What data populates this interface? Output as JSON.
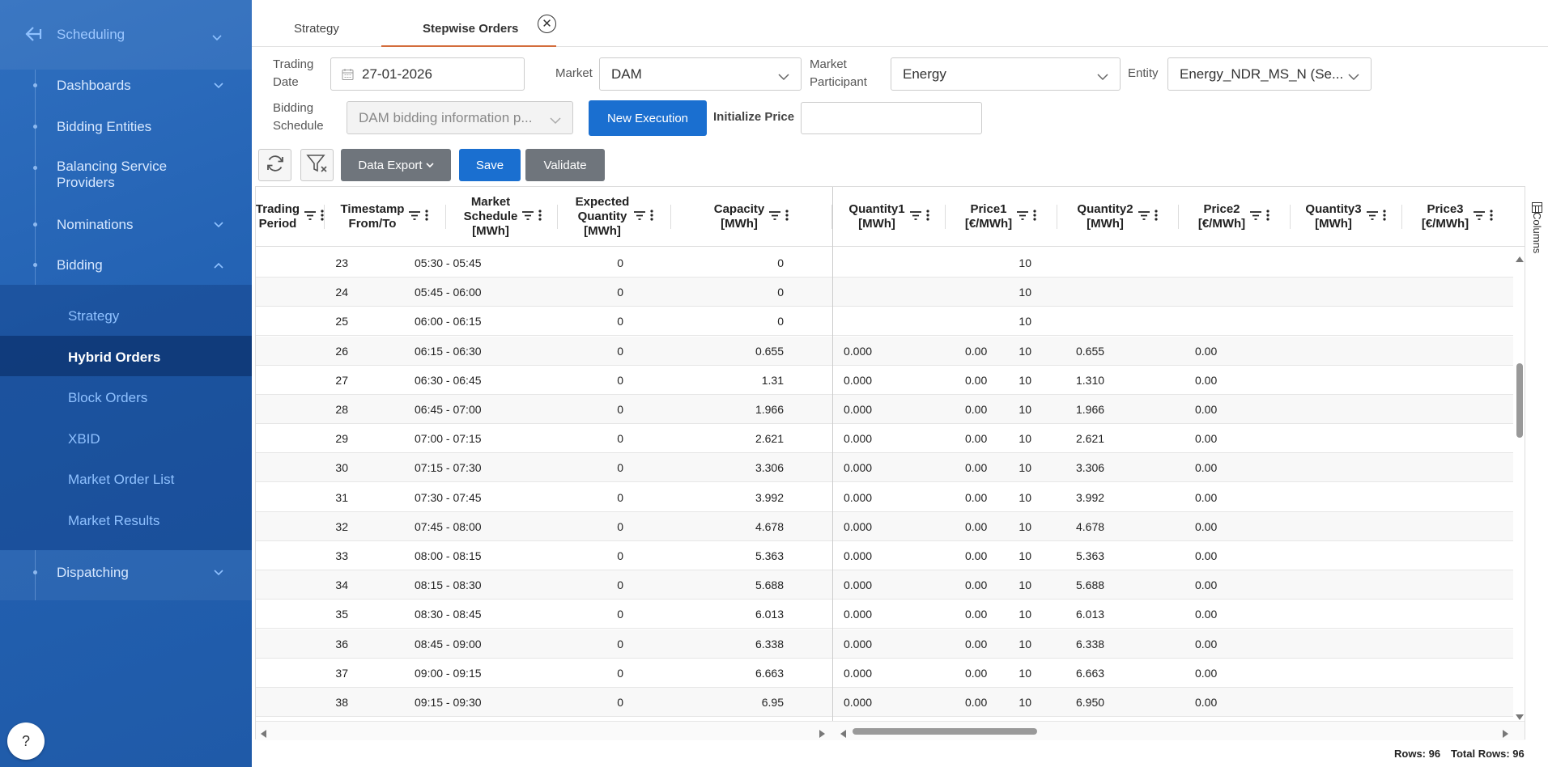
{
  "sidebar": {
    "header": "Scheduling",
    "items": [
      {
        "label": "Dashboards"
      },
      {
        "label": "Bidding Entities"
      },
      {
        "label": "Balancing Service Providers"
      },
      {
        "label": "Nominations"
      },
      {
        "label": "Bidding"
      }
    ],
    "bidding_sub": [
      "Strategy",
      "Hybrid Orders",
      "Block Orders",
      "XBID",
      "Market Order List",
      "Market Results"
    ],
    "dispatching": "Dispatching",
    "help": "?"
  },
  "tabs": [
    {
      "label": "Strategy"
    },
    {
      "label": "Stepwise Orders"
    }
  ],
  "tab_close": "✕",
  "filters": {
    "trading_date_label": "Trading Date",
    "trading_date": "27-01-2026",
    "market_label": "Market",
    "market": "DAM",
    "participant_label": "Market Participant",
    "participant": "Energy",
    "entity_label": "Entity",
    "entity": "Energy_NDR_MS_N (Se...",
    "bidding_schedule_label": "Bidding Schedule",
    "bidding_schedule": "DAM bidding information p...",
    "new_execution": "New Execution",
    "initialize_price_label": "Initialize Price",
    "initialize_price": ""
  },
  "toolbar": {
    "data_export": "Data Export",
    "save": "Save",
    "validate": "Validate"
  },
  "grid": {
    "columns": [
      "Trading\nPeriod",
      "Timestamp\nFrom/To",
      "Market\nSchedule\n[MWh]",
      "Expected\nQuantity\n[MWh]",
      "Capacity\n[MWh]",
      "Quantity1\n[MWh]",
      "Price1\n[€/MWh]",
      "Quantity2\n[MWh]",
      "Price2\n[€/MWh]",
      "Quantity3\n[MWh]",
      "Price3\n[€/MWh]"
    ],
    "rows": [
      [
        "23",
        "05:30 - 05:45",
        "0",
        "0",
        "10",
        "",
        "",
        "",
        ""
      ],
      [
        "24",
        "05:45 - 06:00",
        "0",
        "0",
        "10",
        "",
        "",
        "",
        ""
      ],
      [
        "25",
        "06:00 - 06:15",
        "0",
        "0",
        "10",
        "",
        "",
        "",
        ""
      ],
      [
        "26",
        "06:15 - 06:30",
        "0",
        "0.655",
        "10",
        "0.000",
        "0.00",
        "0.655",
        "0.00"
      ],
      [
        "27",
        "06:30 - 06:45",
        "0",
        "1.31",
        "10",
        "0.000",
        "0.00",
        "1.310",
        "0.00"
      ],
      [
        "28",
        "06:45 - 07:00",
        "0",
        "1.966",
        "10",
        "0.000",
        "0.00",
        "1.966",
        "0.00"
      ],
      [
        "29",
        "07:00 - 07:15",
        "0",
        "2.621",
        "10",
        "0.000",
        "0.00",
        "2.621",
        "0.00"
      ],
      [
        "30",
        "07:15 - 07:30",
        "0",
        "3.306",
        "10",
        "0.000",
        "0.00",
        "3.306",
        "0.00"
      ],
      [
        "31",
        "07:30 - 07:45",
        "0",
        "3.992",
        "10",
        "0.000",
        "0.00",
        "3.992",
        "0.00"
      ],
      [
        "32",
        "07:45 - 08:00",
        "0",
        "4.678",
        "10",
        "0.000",
        "0.00",
        "4.678",
        "0.00"
      ],
      [
        "33",
        "08:00 - 08:15",
        "0",
        "5.363",
        "10",
        "0.000",
        "0.00",
        "5.363",
        "0.00"
      ],
      [
        "34",
        "08:15 - 08:30",
        "0",
        "5.688",
        "10",
        "0.000",
        "0.00",
        "5.688",
        "0.00"
      ],
      [
        "35",
        "08:30 - 08:45",
        "0",
        "6.013",
        "10",
        "0.000",
        "0.00",
        "6.013",
        "0.00"
      ],
      [
        "36",
        "08:45 - 09:00",
        "0",
        "6.338",
        "10",
        "0.000",
        "0.00",
        "6.338",
        "0.00"
      ],
      [
        "37",
        "09:00 - 09:15",
        "0",
        "6.663",
        "10",
        "0.000",
        "0.00",
        "6.663",
        "0.00"
      ],
      [
        "38",
        "09:15 - 09:30",
        "0",
        "6.95",
        "10",
        "0.000",
        "0.00",
        "6.950",
        "0.00"
      ]
    ],
    "columns_panel": "Columns"
  },
  "footer": {
    "rows": "Rows: 96",
    "total_rows": "Total Rows: 96"
  }
}
